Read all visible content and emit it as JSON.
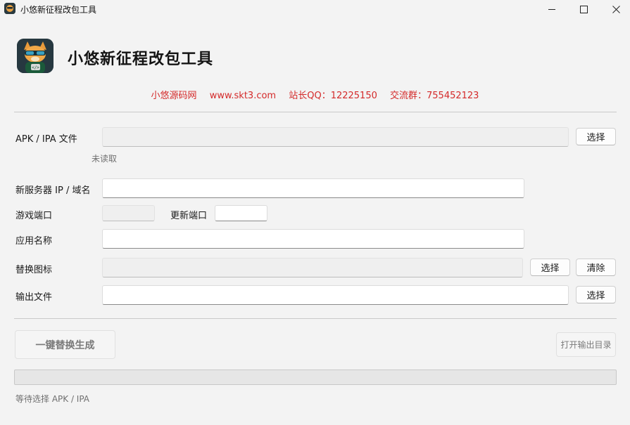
{
  "window": {
    "title": "小悠新征程改包工具"
  },
  "header": {
    "app_title": "小悠新征程改包工具",
    "promo": [
      "小悠源码网",
      "www.skt3.com",
      "站长QQ：12225150",
      "交流群：755452123"
    ],
    "promo_color": "#d42a2a"
  },
  "form": {
    "apk_label": "APK / IPA 文件",
    "apk_value": "",
    "apk_select": "选择",
    "apk_status": "未读取",
    "server_label": "新服务器 IP / 域名",
    "server_value": "",
    "game_port_label": "游戏端口",
    "game_port_value": "",
    "update_port_label": "更新端口",
    "update_port_value": "",
    "app_name_label": "应用名称",
    "app_name_value": "",
    "icon_label": "替换图标",
    "icon_value": "",
    "icon_select": "选择",
    "icon_clear": "清除",
    "output_label": "输出文件",
    "output_value": "",
    "output_select": "选择"
  },
  "actions": {
    "generate": "一键替换生成",
    "open_output": "打开输出目录"
  },
  "progress": {
    "value": 0
  },
  "status": {
    "text": "等待选择 APK / IPA"
  }
}
